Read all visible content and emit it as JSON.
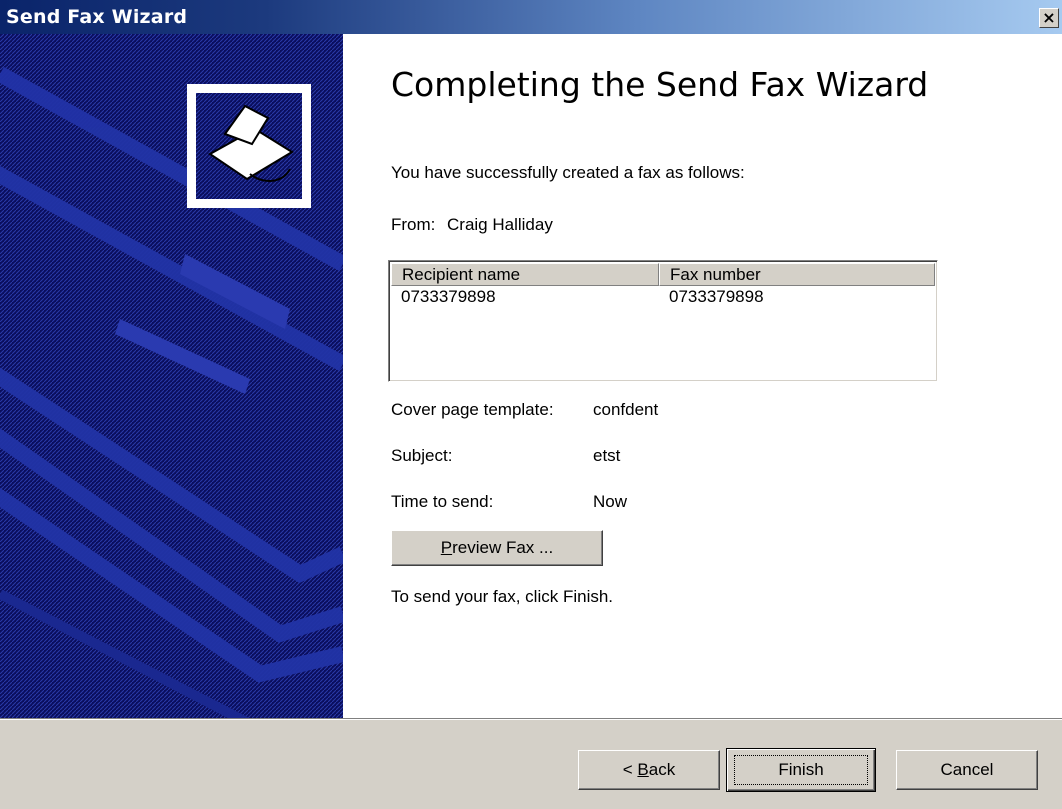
{
  "window": {
    "title": "Send Fax Wizard"
  },
  "icons": {
    "close": "close-icon",
    "fax": "fax-machine-icon"
  },
  "content": {
    "heading": "Completing the Send Fax Wizard",
    "intro": "You have successfully created a fax as follows:",
    "from_label": "From:",
    "from_value": "Craig Halliday",
    "recipients": {
      "columns": [
        "Recipient name",
        "Fax number"
      ],
      "rows": [
        {
          "name": "0733379898",
          "fax": "0733379898"
        }
      ]
    },
    "cover_label": "Cover page template:",
    "cover_value": "confdent",
    "subject_label": "Subject:",
    "subject_value": "etst",
    "time_label": "Time to send:",
    "time_value": "Now",
    "preview_button": {
      "accel": "P",
      "rest": "review Fax ..."
    },
    "instruction": "To send your fax, click Finish."
  },
  "footer": {
    "back_button": {
      "pre": "< ",
      "accel": "B",
      "rest": "ack"
    },
    "finish_button": "Finish",
    "cancel_button": "Cancel"
  },
  "colors": {
    "accent_panel": "#0a0e5e",
    "titlebar_start": "#0a246a",
    "titlebar_end": "#a6caf0",
    "dialog_bg": "#d4d0c8"
  }
}
